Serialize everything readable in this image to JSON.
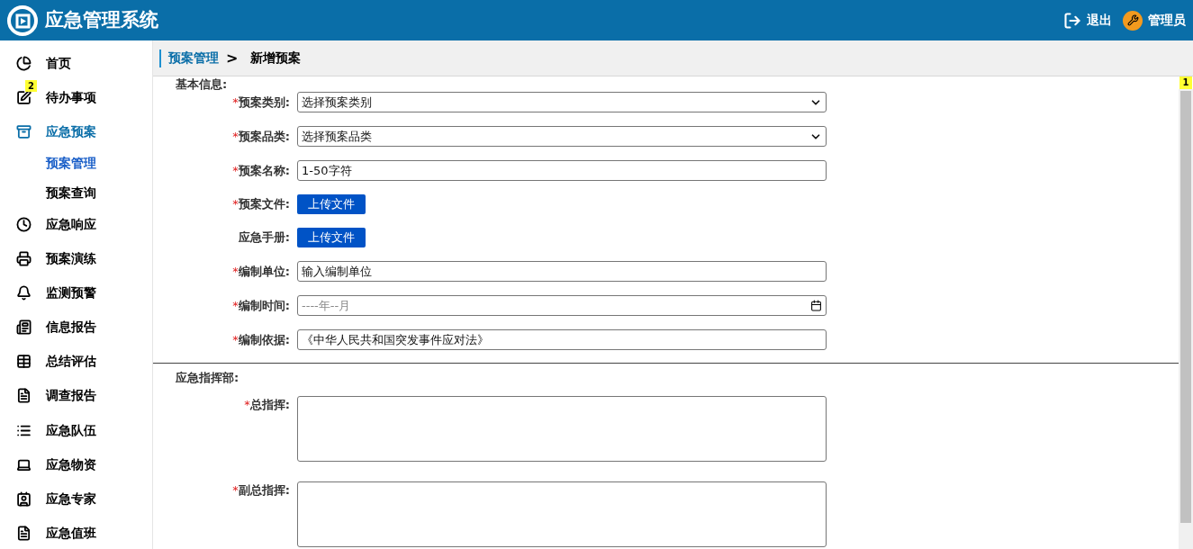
{
  "header": {
    "title": "应急管理系统",
    "logout": "退出",
    "user": "管理员"
  },
  "sidebar": {
    "items": [
      {
        "label": "首页",
        "selected": false
      },
      {
        "label": "待办事项",
        "selected": false,
        "badge": "2"
      },
      {
        "label": "应急预案",
        "selected": true,
        "children": [
          {
            "label": "预案管理",
            "selected": true
          },
          {
            "label": "预案查询",
            "selected": false
          }
        ]
      },
      {
        "label": "应急响应",
        "selected": false
      },
      {
        "label": "预案演练",
        "selected": false
      },
      {
        "label": "监测预警",
        "selected": false
      },
      {
        "label": "信息报告",
        "selected": false
      },
      {
        "label": "总结评估",
        "selected": false
      },
      {
        "label": "调查报告",
        "selected": false
      },
      {
        "label": "应急队伍",
        "selected": false
      },
      {
        "label": "应急物资",
        "selected": false
      },
      {
        "label": "应急专家",
        "selected": false
      },
      {
        "label": "应急值班",
        "selected": false
      }
    ]
  },
  "breadcrumb": [
    "预案管理",
    "新增预案"
  ],
  "breadcrumb_separator": ">",
  "scroll_badge": "1",
  "sections": [
    {
      "title": "基本信息:",
      "fields": [
        {
          "kind": "select",
          "mark": "*",
          "label": "预案类别:",
          "value": "选择预案类别"
        },
        {
          "kind": "select",
          "mark": "*",
          "label": "预案品类:",
          "value": "选择预案品类"
        },
        {
          "kind": "text",
          "mark": "*",
          "label": "预案名称:",
          "value": "1-50字符"
        },
        {
          "kind": "upload",
          "mark": "*",
          "label": "预案文件:",
          "button": "上传文件"
        },
        {
          "kind": "upload",
          "label": "应急手册:",
          "button": "上传文件"
        },
        {
          "kind": "text",
          "mark": "*",
          "label": "编制单位:",
          "value": "输入编制单位"
        },
        {
          "kind": "date",
          "mark": "*",
          "label": "编制时间:",
          "placeholder": "----年--月"
        },
        {
          "kind": "text",
          "mark": "*",
          "label": "编制依据:",
          "value": "《中华人民共和国突发事件应对法》"
        }
      ]
    },
    {
      "title": "应急指挥部:",
      "fields": [
        {
          "kind": "textarea",
          "mark": "*",
          "label": "总指挥:"
        },
        {
          "kind": "textarea",
          "mark": "*",
          "label": "副总指挥:"
        }
      ]
    }
  ]
}
